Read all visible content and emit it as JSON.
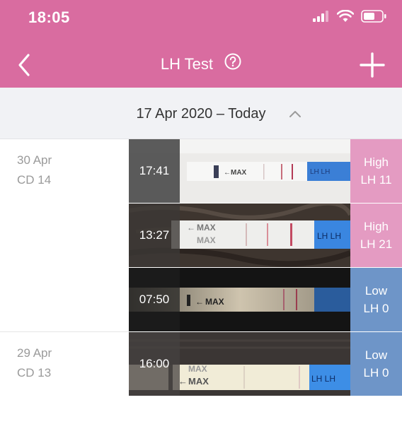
{
  "status_bar": {
    "time": "18:05"
  },
  "nav": {
    "title": "LH Test"
  },
  "range": {
    "label": "17 Apr 2020 – Today"
  },
  "days": [
    {
      "date": "30 Apr",
      "cycle_day": "CD 14"
    },
    {
      "date": "29 Apr",
      "cycle_day": "CD 13"
    }
  ],
  "tests": [
    {
      "time": "17:41",
      "level": "High",
      "value": "LH 11",
      "result_color": "#e49bc2",
      "background": "light"
    },
    {
      "time": "13:27",
      "level": "High",
      "value": "LH 21",
      "result_color": "#e49bc2",
      "background": "leather"
    },
    {
      "time": "07:50",
      "level": "Low",
      "value": "LH 0",
      "result_color": "#6e95c8",
      "background": "dark"
    },
    {
      "time": "16:00",
      "level": "Low",
      "value": "LH 0",
      "result_color": "#6e95c8",
      "background": "fabric"
    }
  ],
  "strip_text": {
    "max": "MAX",
    "lh": "LH LH"
  },
  "colors": {
    "header": "#d96ca0",
    "range_bar": "#f1f2f5",
    "high": "#e49bc2",
    "low": "#6e95c8"
  },
  "icons": [
    "back-chevron-icon",
    "help-circle-icon",
    "plus-icon",
    "chevron-up-icon",
    "signal-icon",
    "wifi-icon",
    "battery-icon"
  ]
}
